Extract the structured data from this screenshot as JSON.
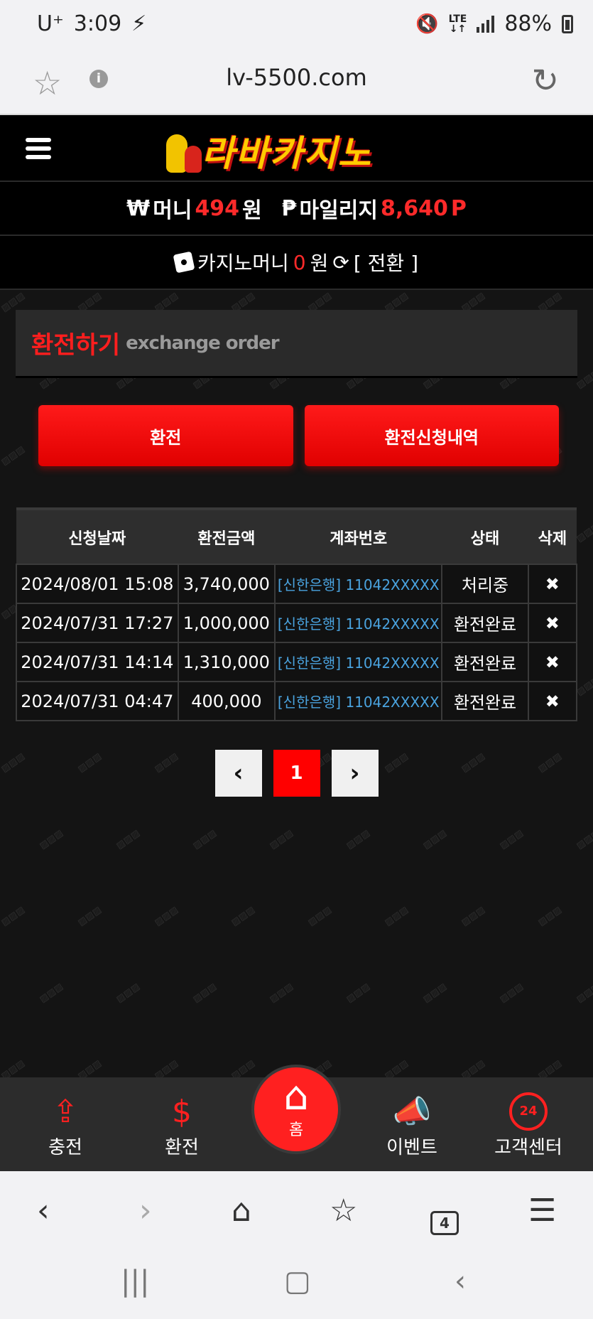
{
  "status_bar": {
    "carrier": "U⁺",
    "time": "3:09",
    "network": "LTE",
    "battery": "88%"
  },
  "browser": {
    "url": "lv-5500.com"
  },
  "site": {
    "logo_text": "라바카지노",
    "money_label": "머니",
    "money_value": "494",
    "money_unit": "원",
    "mileage_label": "마일리지",
    "mileage_value": "8,640",
    "mileage_unit": "P",
    "casino_label": "카지노머니",
    "casino_value": "0",
    "casino_unit": "원",
    "convert_label": "[ 전환 ]"
  },
  "page": {
    "title_ko": "환전하기",
    "title_en": "exchange order",
    "exchange_button": "환전",
    "history_button": "환전신청내역"
  },
  "table": {
    "headers": [
      "신청날짜",
      "환전금액",
      "계좌번호",
      "상태",
      "삭제"
    ],
    "rows": [
      {
        "date": "2024/08/01 15:08",
        "amount": "3,740,000",
        "account": "[신한은행] 11042XXXXX",
        "status": "처리중",
        "del": "✖"
      },
      {
        "date": "2024/07/31 17:27",
        "amount": "1,000,000",
        "account": "[신한은행] 11042XXXXX",
        "status": "환전완료",
        "del": "✖"
      },
      {
        "date": "2024/07/31 14:14",
        "amount": "1,310,000",
        "account": "[신한은행] 11042XXXXX",
        "status": "환전완료",
        "del": "✖"
      },
      {
        "date": "2024/07/31 04:47",
        "amount": "400,000",
        "account": "[신한은행] 11042XXXXX",
        "status": "환전완료",
        "del": "✖"
      }
    ]
  },
  "pager": {
    "prev": "‹",
    "current": "1",
    "next": "›"
  },
  "bottom_nav": {
    "charge": "충전",
    "exchange": "환전",
    "home": "홈",
    "event": "이벤트",
    "support": "고객센터",
    "support_badge": "24"
  },
  "browser_bar": {
    "tab_count": "4"
  }
}
